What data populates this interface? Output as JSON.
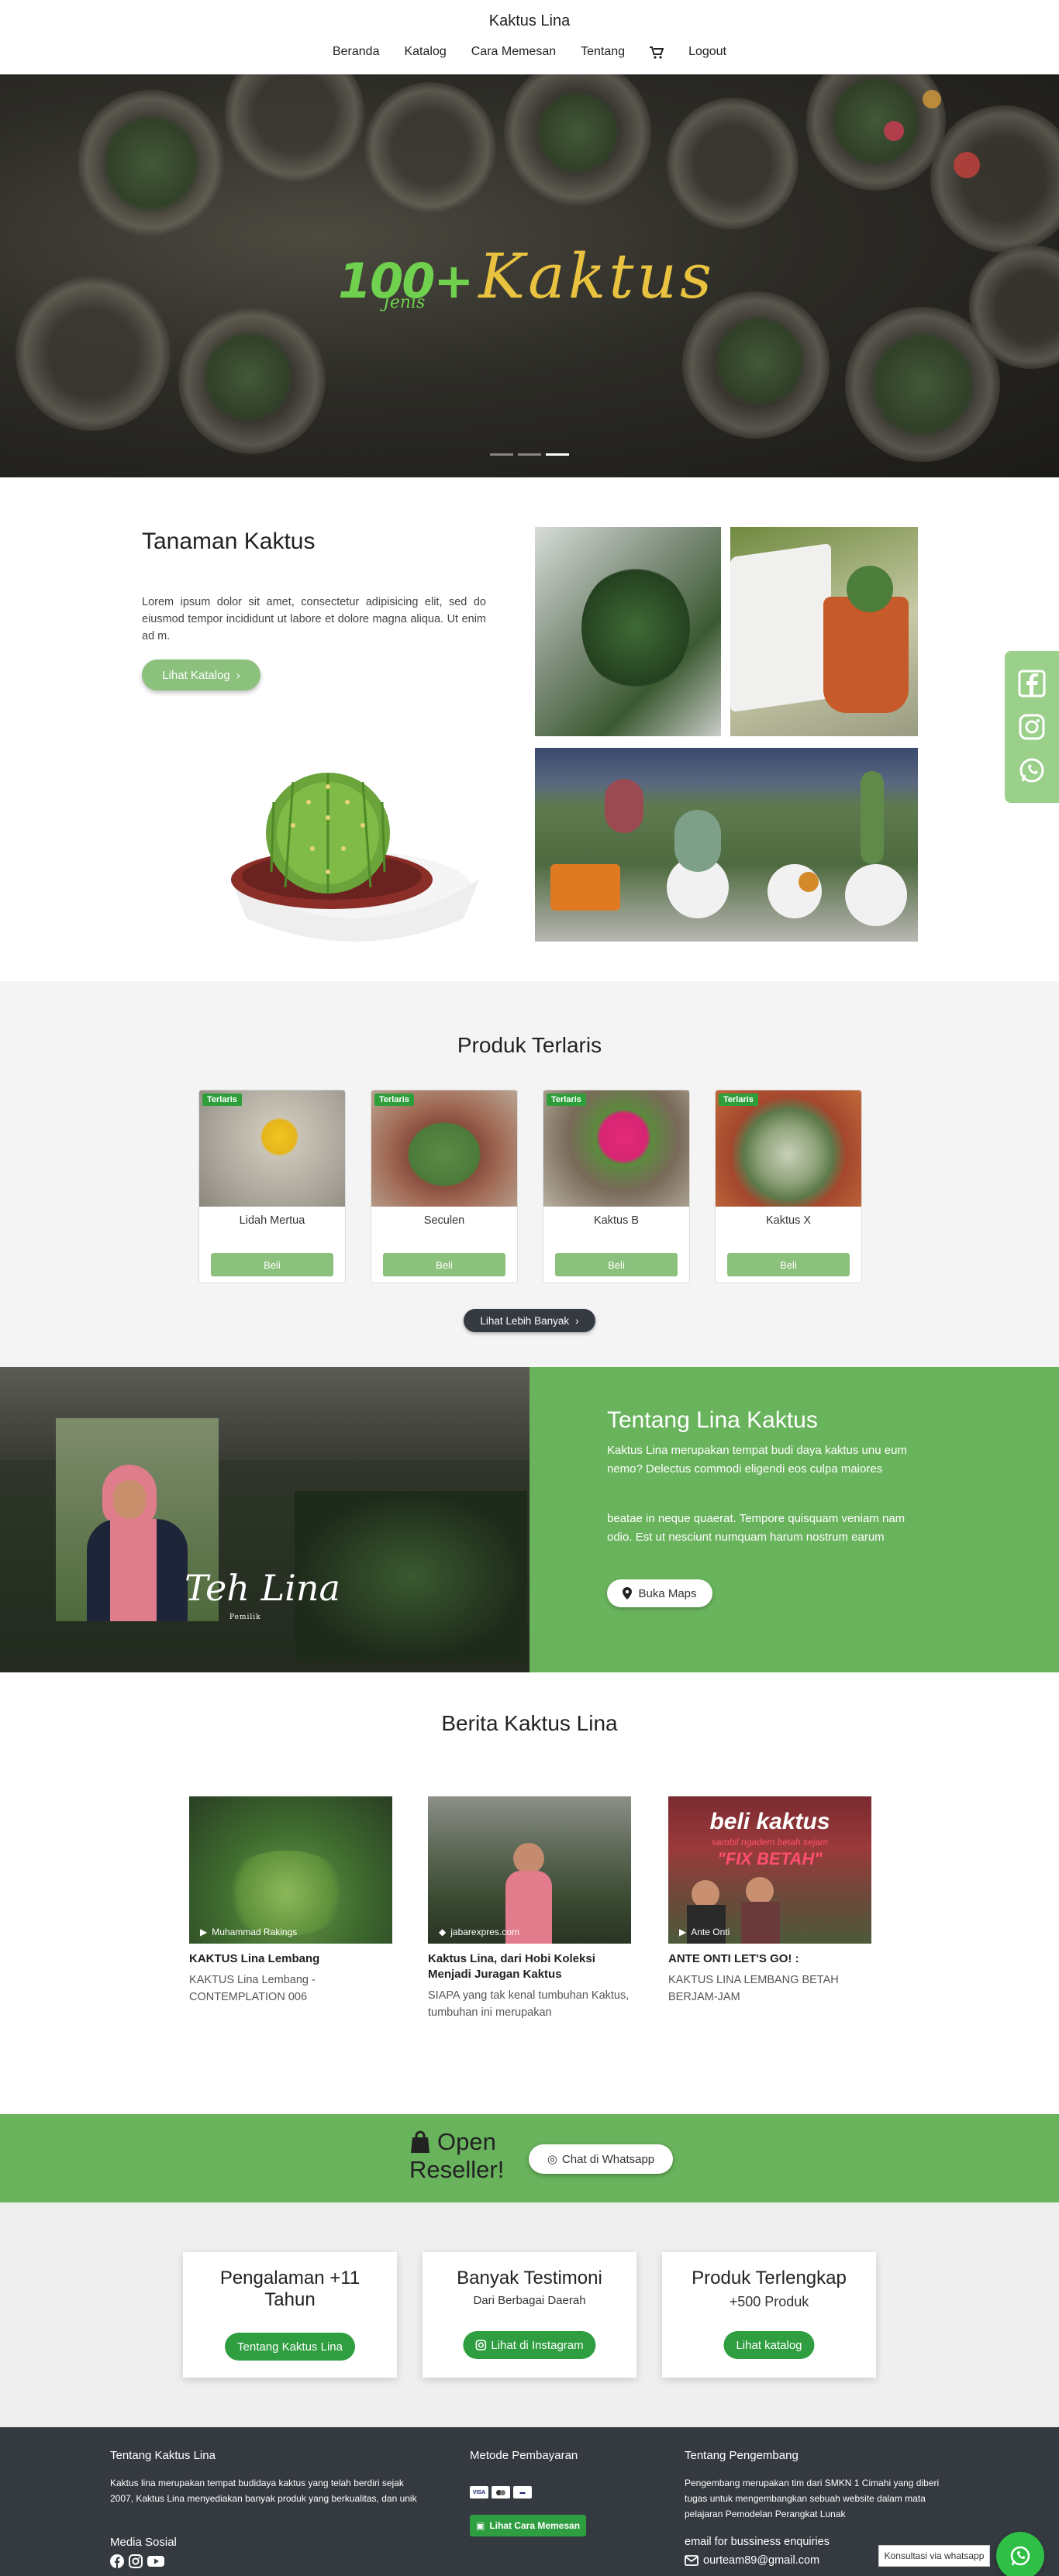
{
  "navbar": {
    "brand": "Kaktus Lina",
    "links": [
      "Beranda",
      "Katalog",
      "Cara Memesan",
      "Tentang"
    ],
    "logout": "Logout"
  },
  "hero": {
    "number": "100+",
    "sub": "Jenis",
    "word": "Kaktus"
  },
  "tanaman": {
    "title": "Tanaman Kaktus",
    "text": "Lorem ipsum dolor sit amet, consectetur adipisicing elit, sed do eiusmod tempor incididunt ut labore et dolore magna aliqua. Ut enim ad m.",
    "button": "Lihat Katalog"
  },
  "produk": {
    "title": "Produk Terlaris",
    "badge": "Terlaris",
    "buy_label": "Beli",
    "items": [
      {
        "name": "Lidah Mertua"
      },
      {
        "name": "Seculen"
      },
      {
        "name": "Kaktus B"
      },
      {
        "name": "Kaktus X"
      }
    ],
    "more": "Lihat Lebih Banyak"
  },
  "tentang": {
    "owner_name": "Teh Lina",
    "owner_role": "Pemilik",
    "title": "Tentang Lina Kaktus",
    "p1": "Kaktus Lina merupakan tempat budi daya kaktus unu eum nemo? Delectus commodi eligendi eos culpa maiores",
    "p2": "beatae in neque quaerat. Tempore quisquam veniam nam odio. Est ut nesciunt numquam harum nostrum earum",
    "button": "Buka Maps"
  },
  "berita": {
    "title": "Berita Kaktus Lina",
    "items": [
      {
        "credit": "Muhammad Rakings",
        "title": "KAKTUS Lina Lembang",
        "body": "KAKTUS Lina Lembang - CONTEMPLATION 006"
      },
      {
        "credit": "jabarexpres.com",
        "title": "Kaktus Lina, dari Hobi Koleksi Menjadi Juragan Kaktus",
        "body": "SIAPA yang tak kenal tumbuhan Kaktus, tumbuhan ini merupakan"
      },
      {
        "credit": "Ante Onti",
        "title": "ANTE ONTI LET'S GO! :",
        "body": "KAKTUS LINA LEMBANG BETAH BERJAM-JAM",
        "overlay1": "beli kaktus",
        "overlay2": "sambil ngadem betah sejam",
        "overlay3": "\"FIX BETAH\""
      }
    ]
  },
  "reseller": {
    "line1": "Open",
    "line2": "Reseller!",
    "button": "Chat di Whatsapp"
  },
  "features": [
    {
      "title": "Pengalaman +11 Tahun",
      "sub": "",
      "button": "Tentang Kaktus Lina"
    },
    {
      "title": "Banyak Testimoni",
      "sub": "Dari Berbagai Daerah",
      "button": "Lihat di Instagram"
    },
    {
      "title": "Produk Terlengkap",
      "sub": "+500 Produk",
      "button": "Lihat katalog"
    }
  ],
  "footer": {
    "col1_title": "Tentang Kaktus Lina",
    "col1_text": "Kaktus lina merupakan tempat budidaya kaktus yang telah berdiri sejak 2007, Kaktus Lina menyediakan banyak produk yang berkualitas, dan unik",
    "social_title": "Media Sosial",
    "col2_title": "Metode Pembayaran",
    "cara_button": "Lihat Cara Memesan",
    "col3_title": "Tentang Pengembang",
    "col3_text": "Pengembang merupakan tim dari SMKN 1 Cimahi yang diberi tugas untuk mengembangkan sebuah website dalam mata pelajaran Pemodelan Perangkat Lunak",
    "email_title": "email for bussiness enquiries",
    "email": "ourteam89@gmail.com"
  },
  "wa_float": {
    "tooltip": "Konsultasi via whatsapp"
  },
  "colors": {
    "green": "#69b35c",
    "green_soft": "#8bc17c",
    "green_button": "#2f9e41",
    "footer": "#343a40"
  }
}
